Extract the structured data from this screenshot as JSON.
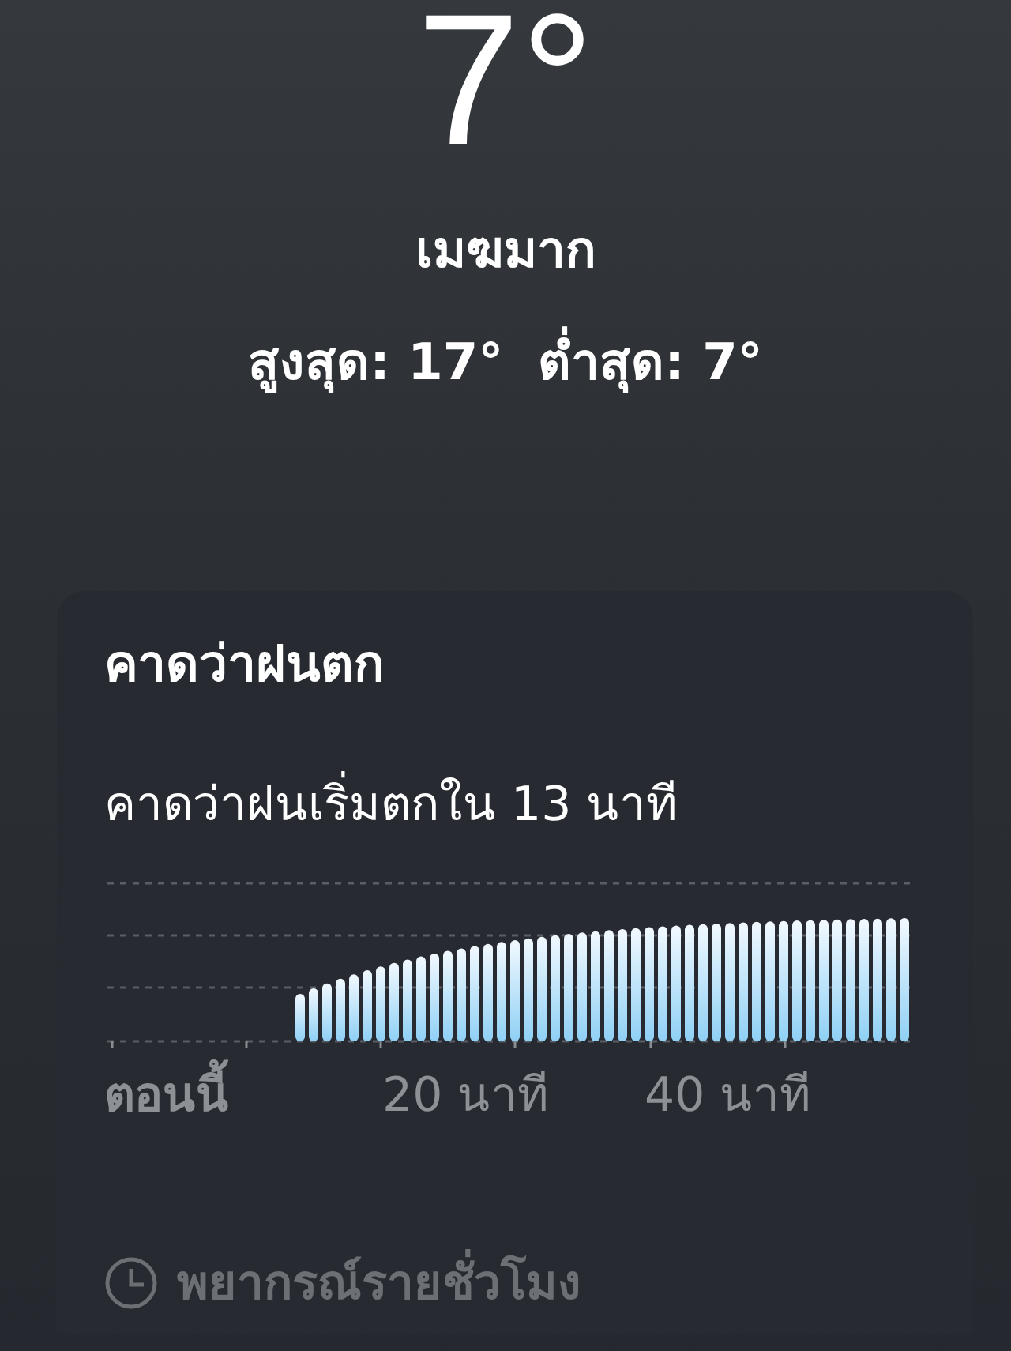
{
  "current": {
    "temperature": "7°",
    "condition": "เมฆมาก",
    "high": "สูงสุด: 17°",
    "low": "ต่ำสุด: 7°"
  },
  "precipitation_card": {
    "title": "คาดว่าฝนตก",
    "summary": "คาดว่าฝนเริ่มตกใน 13 นาที",
    "x_labels": [
      {
        "label": "ตอนนี้",
        "kind": "now"
      },
      {
        "label": "20 นาที",
        "kind": "time"
      },
      {
        "label": "40 นาที",
        "kind": "time"
      }
    ]
  },
  "footer": {
    "label": "พยากรณ์รายชั่วโมง"
  }
}
